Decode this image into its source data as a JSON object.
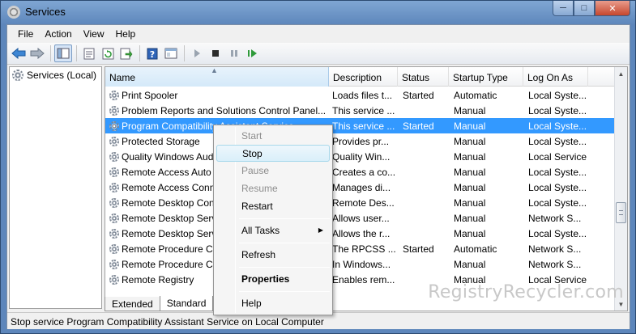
{
  "window": {
    "title": "Services"
  },
  "menu": [
    "File",
    "Action",
    "View",
    "Help"
  ],
  "toolbar_icons": [
    "back-arrow-icon",
    "forward-arrow-icon",
    "console-tree-icon",
    "properties-sheet-icon",
    "refresh-icon",
    "export-list-icon",
    "help-icon",
    "view-icon",
    "play-icon",
    "stop-icon",
    "pause-icon",
    "restart-icon"
  ],
  "tree": {
    "root": "Services (Local)"
  },
  "columns": {
    "name": "Name",
    "description": "Description",
    "status": "Status",
    "startup": "Startup Type",
    "logon": "Log On As"
  },
  "rows": [
    {
      "name": "Print Spooler",
      "description": "Loads files t...",
      "status": "Started",
      "startup": "Automatic",
      "logon": "Local Syste..."
    },
    {
      "name": "Problem Reports and Solutions Control Panel...",
      "description": "This service ...",
      "status": "",
      "startup": "Manual",
      "logon": "Local Syste..."
    },
    {
      "name": "Program Compatibility Assistant Service",
      "description": "This service ...",
      "status": "Started",
      "startup": "Manual",
      "logon": "Local Syste...",
      "selected": true
    },
    {
      "name": "Protected Storage",
      "description": "Provides pr...",
      "status": "",
      "startup": "Manual",
      "logon": "Local Syste..."
    },
    {
      "name": "Quality Windows Audio Video Experience",
      "description": "Quality Win...",
      "status": "",
      "startup": "Manual",
      "logon": "Local Service"
    },
    {
      "name": "Remote Access Auto Connection Manager",
      "description": "Creates a co...",
      "status": "",
      "startup": "Manual",
      "logon": "Local Syste..."
    },
    {
      "name": "Remote Access Connection Manager",
      "description": "Manages di...",
      "status": "",
      "startup": "Manual",
      "logon": "Local Syste..."
    },
    {
      "name": "Remote Desktop Configuration",
      "description": "Remote Des...",
      "status": "",
      "startup": "Manual",
      "logon": "Local Syste..."
    },
    {
      "name": "Remote Desktop Services",
      "description": "Allows user...",
      "status": "",
      "startup": "Manual",
      "logon": "Network S..."
    },
    {
      "name": "Remote Desktop Services UserMode Port Redirector",
      "description": "Allows the r...",
      "status": "",
      "startup": "Manual",
      "logon": "Local Syste..."
    },
    {
      "name": "Remote Procedure Call (RPC)",
      "description": "The RPCSS ...",
      "status": "Started",
      "startup": "Automatic",
      "logon": "Network S..."
    },
    {
      "name": "Remote Procedure Call (RPC) Locator",
      "description": "In Windows...",
      "status": "",
      "startup": "Manual",
      "logon": "Network S..."
    },
    {
      "name": "Remote Registry",
      "description": "Enables rem...",
      "status": "",
      "startup": "Manual",
      "logon": "Local Service"
    }
  ],
  "tabs": [
    "Extended",
    "Standard"
  ],
  "context_menu": {
    "start": "Start",
    "stop": "Stop",
    "pause": "Pause",
    "resume": "Resume",
    "restart": "Restart",
    "all_tasks": "All Tasks",
    "refresh": "Refresh",
    "properties": "Properties",
    "help": "Help"
  },
  "statusbar": {
    "text": "Stop service Program Compatibility Assistant Service on Local Computer"
  },
  "watermark": "RegistryRecycler.com",
  "colors": {
    "selection": "#3399ff",
    "titlebar": "#5d86bb",
    "close_button": "#c6472e"
  }
}
